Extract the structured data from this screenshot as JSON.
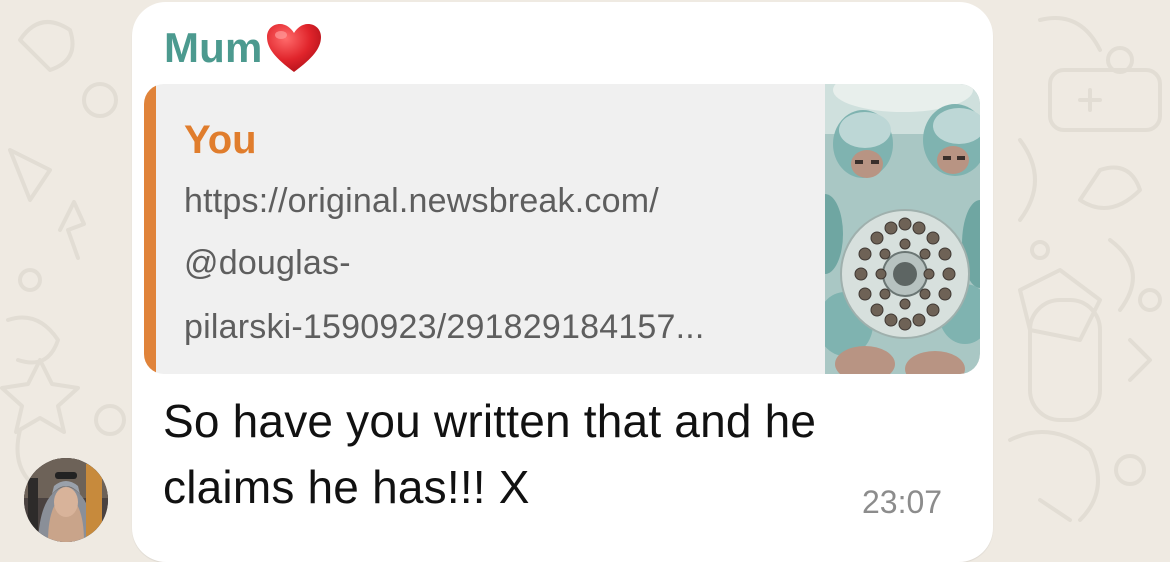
{
  "chat": {
    "background_color": "#efeae2",
    "contact_avatar_icon": "avatar-photo"
  },
  "message": {
    "sender_name": "Mum",
    "sender_emoji": "❤️",
    "sender_color": "#4c9a8f",
    "quote": {
      "author": "You",
      "author_color": "#e07d2d",
      "bar_color": "#e0833a",
      "link_lines": [
        "https://original.newsbreak.com/",
        "@douglas-",
        "pilarski-1590923/291829184157..."
      ],
      "thumbnail_icon": "surgeons-operating-light-photo"
    },
    "text_lines": [
      "So have you written that and he",
      "claims he has!!! X"
    ],
    "time": "23:07"
  }
}
